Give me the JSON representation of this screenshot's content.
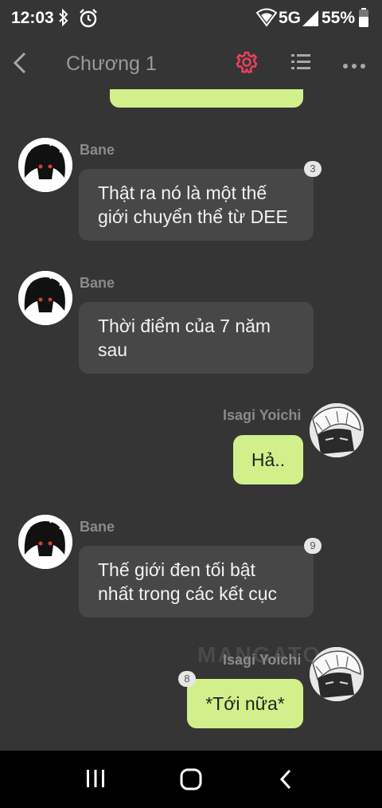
{
  "status": {
    "time": "12:03",
    "network": "5G",
    "battery": "55%"
  },
  "header": {
    "title": "Chương 1",
    "accent": "#e8405f"
  },
  "messages": [
    {
      "sender": "Bane",
      "text": "Thật ra nó là một thế giới chuyển thể từ DEE",
      "badge": "3"
    },
    {
      "sender": "Bane",
      "text": "Thời điểm của 7 năm sau",
      "badge": ""
    },
    {
      "sender": "Isagi Yoichi",
      "text": "Hả..",
      "badge": ""
    },
    {
      "sender": "Bane",
      "text": "Thế giới đen tối bật nhất trong các kết cục",
      "badge": "9"
    },
    {
      "sender": "Isagi Yoichi",
      "text": "*Tới nữa*",
      "badge": "8"
    }
  ],
  "watermark": "MANGATO"
}
